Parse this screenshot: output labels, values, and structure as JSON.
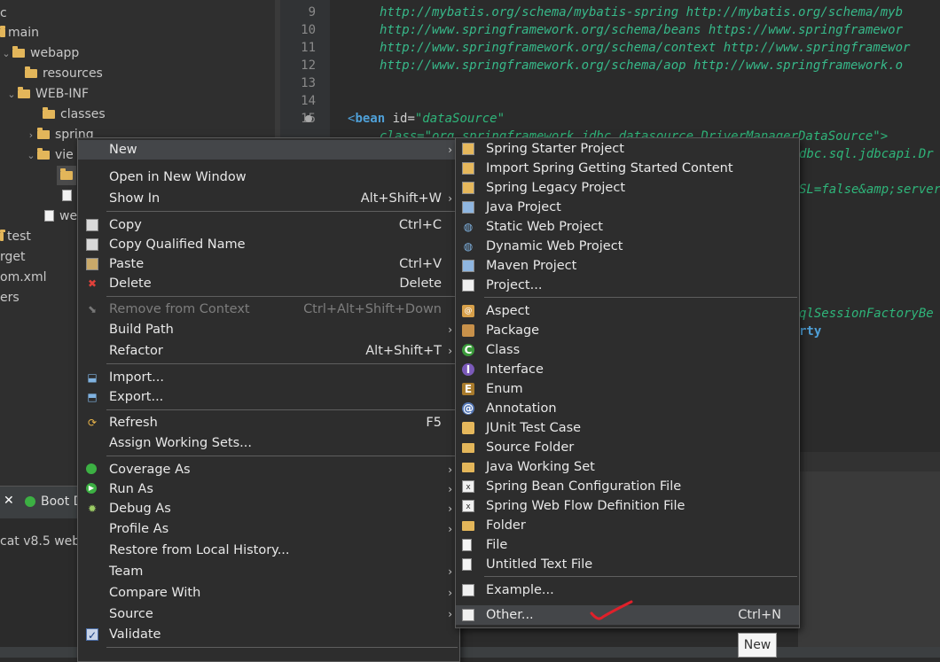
{
  "explorer": {
    "rows": [
      {
        "label": "c"
      },
      {
        "label": "main"
      },
      {
        "label": "webapp"
      },
      {
        "label": "resources"
      },
      {
        "label": "WEB-INF"
      },
      {
        "label": "classes"
      },
      {
        "label": "spring"
      },
      {
        "label": "vie"
      },
      {
        "label": ""
      },
      {
        "label": ""
      },
      {
        "label": "we"
      },
      {
        "label": "test"
      },
      {
        "label": "rget"
      },
      {
        "label": "om.xml"
      },
      {
        "label": "ers"
      }
    ]
  },
  "bottom_panel": {
    "tab_label": "Boot D",
    "server_text": "cat v8.5 webl"
  },
  "editor": {
    "lines": [
      {
        "num": "9",
        "text": "http://mybatis.org/schema/mybatis-spring http://mybatis.org/schema/myb"
      },
      {
        "num": "10",
        "text": "http://www.springframework.org/schema/beans https://www.springframewor"
      },
      {
        "num": "11",
        "text": "http://www.springframework.org/schema/context http://www.springframewor"
      },
      {
        "num": "12",
        "text": "http://www.springframework.org/schema/aop http://www.springframework.o"
      },
      {
        "num": "13",
        "text": ""
      },
      {
        "num": "14",
        "text": ""
      },
      {
        "num": "15",
        "text": ""
      }
    ],
    "bean_line": {
      "open": "<",
      "tag": "bean",
      "attr": " id=",
      "value": "\"dataSource\""
    },
    "frag_class": "class=\"org.springframework.jdbc.datasource.DriverManagerDataSource\">",
    "frag_driver": "dbc.sql.jdbcapi.Dr",
    "frag_ssl": "SL=false&amp;server",
    "frag_factory": "qlSessionFactoryBe",
    "frag_property": "rty"
  },
  "context_menu": {
    "items": [
      {
        "label": "New",
        "accel": "",
        "submenu": true,
        "highlight": true
      },
      {
        "label": "Open in New Window",
        "accel": ""
      },
      {
        "label": "Show In",
        "accel": "Alt+Shift+W",
        "submenu": true
      },
      {
        "label": "Copy",
        "accel": "Ctrl+C"
      },
      {
        "label": "Copy Qualified Name",
        "accel": ""
      },
      {
        "label": "Paste",
        "accel": "Ctrl+V"
      },
      {
        "label": "Delete",
        "accel": "Delete"
      },
      {
        "label": "Remove from Context",
        "accel": "Ctrl+Alt+Shift+Down",
        "disabled": true
      },
      {
        "label": "Build Path",
        "accel": "",
        "submenu": true
      },
      {
        "label": "Refactor",
        "accel": "Alt+Shift+T",
        "submenu": true
      },
      {
        "label": "Import...",
        "accel": ""
      },
      {
        "label": "Export...",
        "accel": ""
      },
      {
        "label": "Refresh",
        "accel": "F5"
      },
      {
        "label": "Assign Working Sets...",
        "accel": ""
      },
      {
        "label": "Coverage As",
        "accel": "",
        "submenu": true
      },
      {
        "label": "Run As",
        "accel": "",
        "submenu": true
      },
      {
        "label": "Debug As",
        "accel": "",
        "submenu": true
      },
      {
        "label": "Profile As",
        "accel": "",
        "submenu": true
      },
      {
        "label": "Restore from Local History...",
        "accel": ""
      },
      {
        "label": "Team",
        "accel": "",
        "submenu": true
      },
      {
        "label": "Compare With",
        "accel": "",
        "submenu": true
      },
      {
        "label": "Source",
        "accel": "",
        "submenu": true
      },
      {
        "label": "Validate",
        "accel": ""
      }
    ]
  },
  "submenu": {
    "items": [
      {
        "label": "Spring Starter Project",
        "accel": ""
      },
      {
        "label": "Import Spring Getting Started Content",
        "accel": ""
      },
      {
        "label": "Spring Legacy Project",
        "accel": ""
      },
      {
        "label": "Java Project",
        "accel": ""
      },
      {
        "label": "Static Web Project",
        "accel": ""
      },
      {
        "label": "Dynamic Web Project",
        "accel": ""
      },
      {
        "label": "Maven Project",
        "accel": ""
      },
      {
        "label": "Project...",
        "accel": ""
      },
      {
        "label": "Aspect",
        "accel": ""
      },
      {
        "label": "Package",
        "accel": ""
      },
      {
        "label": "Class",
        "accel": ""
      },
      {
        "label": "Interface",
        "accel": ""
      },
      {
        "label": "Enum",
        "accel": ""
      },
      {
        "label": "Annotation",
        "accel": ""
      },
      {
        "label": "JUnit Test Case",
        "accel": ""
      },
      {
        "label": "Source Folder",
        "accel": ""
      },
      {
        "label": "Java Working Set",
        "accel": ""
      },
      {
        "label": "Spring Bean Configuration File",
        "accel": ""
      },
      {
        "label": "Spring Web Flow Definition File",
        "accel": ""
      },
      {
        "label": "Folder",
        "accel": ""
      },
      {
        "label": "File",
        "accel": ""
      },
      {
        "label": "Untitled Text File",
        "accel": ""
      },
      {
        "label": "Example...",
        "accel": ""
      },
      {
        "label": "Other...",
        "accel": "Ctrl+N",
        "highlight": true
      }
    ]
  },
  "tooltip": {
    "text": "New"
  },
  "colors": {
    "highlight": "#444649",
    "annotation_mark": "#e0202a"
  }
}
